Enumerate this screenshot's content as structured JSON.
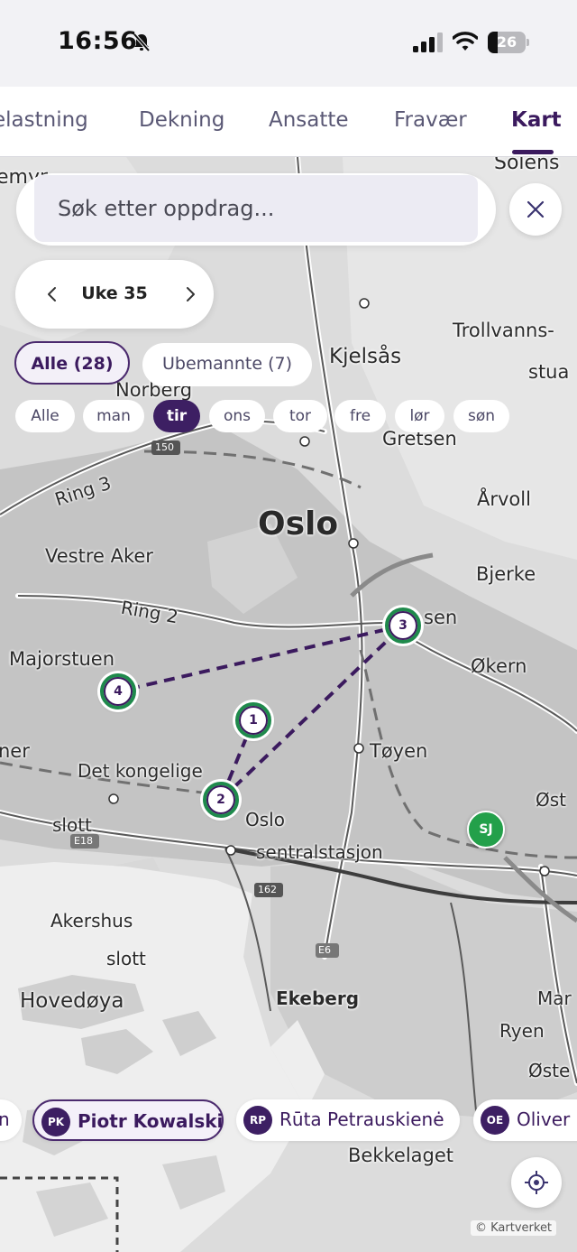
{
  "status_bar": {
    "time": "16:56",
    "battery": "26",
    "battery_level": 0.26,
    "icons": [
      "bell-slash-icon",
      "signal-icon",
      "wifi-icon",
      "battery-icon"
    ]
  },
  "tabs": [
    {
      "label": "elastning",
      "active": false
    },
    {
      "label": "Dekning",
      "active": false
    },
    {
      "label": "Ansatte",
      "active": false
    },
    {
      "label": "Fravær",
      "active": false
    },
    {
      "label": "Kart",
      "active": true
    }
  ],
  "search": {
    "placeholder": "Søk etter oppdrag..."
  },
  "week": {
    "label": "Uke 35"
  },
  "filters": {
    "all": "Alle (28)",
    "unstaffed": "Ubemannte (7)"
  },
  "days": [
    {
      "label": "Alle",
      "active": false
    },
    {
      "label": "man",
      "active": false
    },
    {
      "label": "tir",
      "active": true
    },
    {
      "label": "ons",
      "active": false
    },
    {
      "label": "tor",
      "active": false
    },
    {
      "label": "fre",
      "active": false
    },
    {
      "label": "lør",
      "active": false
    },
    {
      "label": "søn",
      "active": false
    }
  ],
  "map": {
    "labels": {
      "oslo": "Oslo",
      "kjelsas": "Kjelsås",
      "trollvanns": "Trollvanns-",
      "stua": "stua",
      "norberg": "Norberg",
      "gretsen": "Gretsen",
      "ring3": "Ring 3",
      "arvoll": "Årvoll",
      "vestre_aker": "Vestre Aker",
      "bjerke": "Bjerke",
      "ring2": "Ring 2",
      "sen": "sen",
      "majorstuen": "Majorstuen",
      "okern": "Økern",
      "toyen": "Tøyen",
      "ner": "ner",
      "det_kongelige": "Det kongelige",
      "slott_top": "slott",
      "oslo_s": "Oslo",
      "sentralstasjon": "sentralstasjon",
      "ost": "Øst",
      "akershus": "Akershus",
      "slott_bottom": "slott",
      "hovedoya": "Hovedøya",
      "ekeberg": "Ekeberg",
      "ryen": "Ryen",
      "mar": "Mar",
      "oste": "Øste",
      "bekkelaget": "Bekkelaget",
      "solens": "Solens",
      "emyr": "emyr",
      "road_150": "150",
      "road_162": "162",
      "road_e18": "E18",
      "road_e6": "E6"
    },
    "markers": [
      "1",
      "2",
      "3",
      "4"
    ],
    "employee_marker": "SJ",
    "attribution": "© Kartverket"
  },
  "employees": [
    {
      "initials": "",
      "name": "n",
      "active": false
    },
    {
      "initials": "PK",
      "name": "Piotr Kowalski",
      "active": true
    },
    {
      "initials": "RP",
      "name": "Rūta Petrauskienė",
      "active": false
    },
    {
      "initials": "OE",
      "name": "Oliver",
      "active": false
    }
  ],
  "colors": {
    "brand": "#3b1a5e",
    "marker_ring": "#1f8a4c",
    "employee_marker": "#23a04a"
  }
}
